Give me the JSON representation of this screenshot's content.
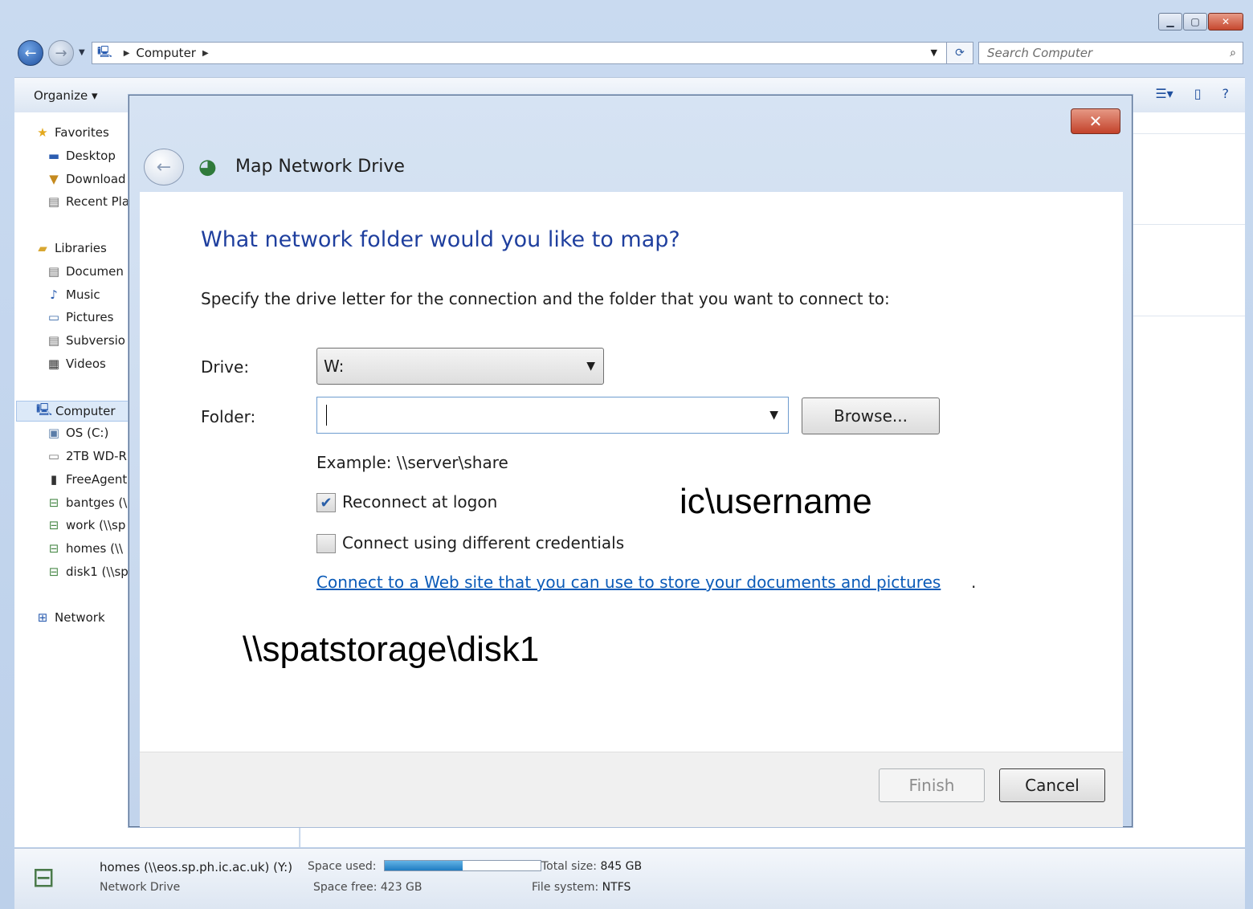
{
  "explorer": {
    "address": {
      "root_icon": "computer-icon",
      "crumb": "Computer"
    },
    "search_placeholder": "Search Computer",
    "toolbar": {
      "organize": "Organize ▾"
    },
    "nav": {
      "favorites": "Favorites",
      "favorites_items": [
        "Desktop",
        "Download",
        "Recent Pla"
      ],
      "libraries": "Libraries",
      "libraries_items": [
        "Documen",
        "Music",
        "Pictures",
        "Subversio",
        "Videos"
      ],
      "computer": "Computer",
      "computer_items": [
        "OS (C:)",
        "2TB WD-R",
        "FreeAgent",
        "bantges (\\",
        "work (\\\\sp",
        "homes (\\\\",
        "disk1 (\\\\sp"
      ],
      "network": "Network"
    },
    "details": {
      "name": "homes (\\\\eos.sp.ph.ic.ac.uk) (Y:)",
      "type": "Network Drive",
      "space_used_label": "Space used:",
      "space_used_fraction": 0.5,
      "space_free": "Space free: 423 GB",
      "total_size_label": "Total size:",
      "total_size_value": "845 GB",
      "fs_label": "File system:",
      "fs_value": "NTFS"
    }
  },
  "dialog": {
    "title": "Map Network Drive",
    "heading": "What network folder would you like to map?",
    "instruction": "Specify the drive letter for the connection and the folder that you want to connect to:",
    "drive_label": "Drive:",
    "drive_value": "W:",
    "folder_label": "Folder:",
    "folder_value": "",
    "browse_label": "Browse...",
    "example": "Example: \\\\server\\share",
    "reconnect_label": "Reconnect at logon",
    "reconnect_checked": true,
    "credentials_label": "Connect using different credentials",
    "credentials_checked": false,
    "web_link": "Connect to a Web site that you can use to store your documents and pictures",
    "web_link_suffix": ".",
    "finish_label": "Finish",
    "cancel_label": "Cancel"
  },
  "annotations": {
    "username": "ic\\username",
    "share_path": "\\\\spatstorage\\disk1"
  },
  "colors": {
    "heading": "#1f3f9e",
    "link": "#0b5bb8",
    "close_button": "#c3422a"
  }
}
